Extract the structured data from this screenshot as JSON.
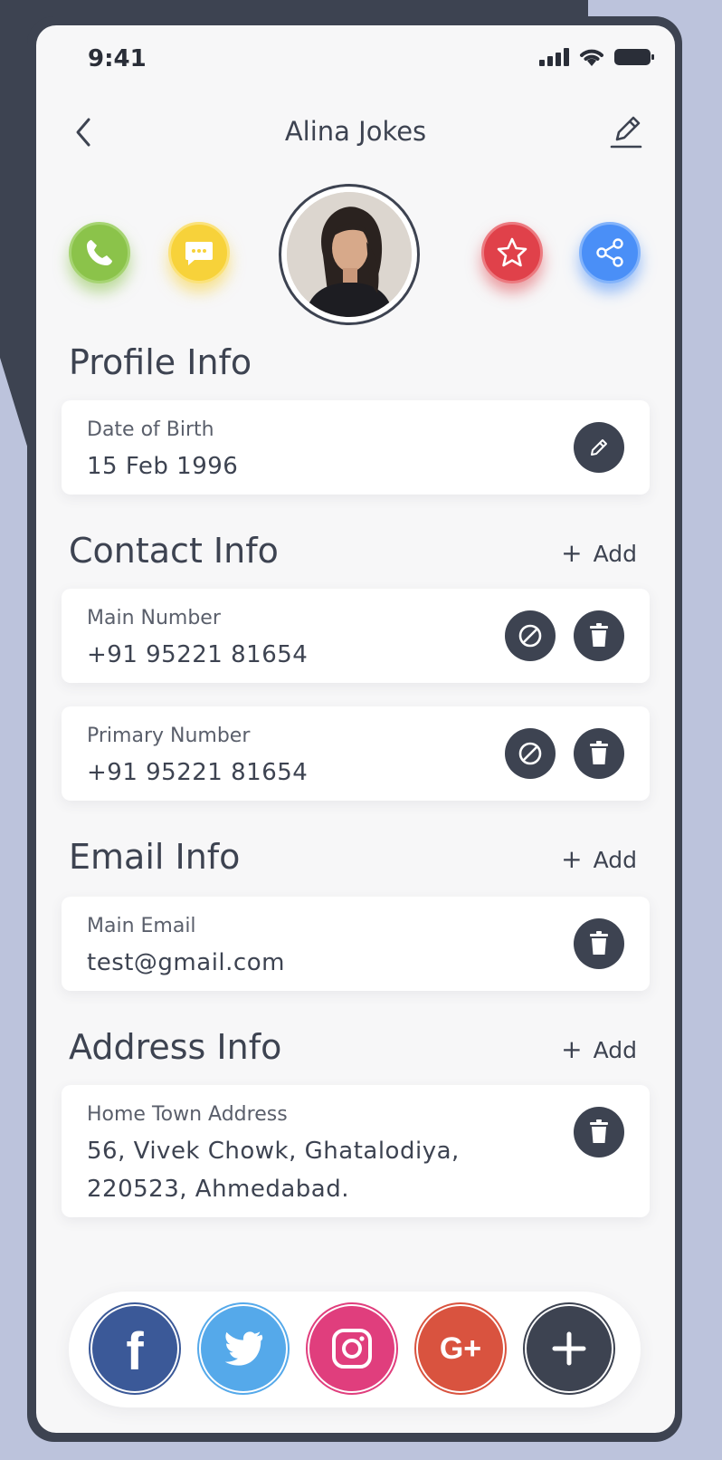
{
  "status": {
    "time": "9:41"
  },
  "header": {
    "title": "Alina Jokes"
  },
  "actions": [
    "call",
    "message",
    "favorite",
    "share"
  ],
  "profile": {
    "title": "Profile Info",
    "dob_label": "Date of Birth",
    "dob_value": "15 Feb 1996"
  },
  "contact": {
    "title": "Contact Info",
    "add_label": "Add",
    "items": [
      {
        "label": "Main Number",
        "value": "+91 95221 81654"
      },
      {
        "label": "Primary Number",
        "value": "+91 95221 81654"
      }
    ]
  },
  "email": {
    "title": "Email Info",
    "add_label": "Add",
    "items": [
      {
        "label": "Main Email",
        "value": "test@gmail.com"
      }
    ]
  },
  "address": {
    "title": "Address Info",
    "add_label": "Add",
    "items": [
      {
        "label": "Home Town Address",
        "line1": "56, Vivek Chowk, Ghatalodiya,",
        "line2": "220523, Ahmedabad."
      }
    ]
  },
  "social": {
    "facebook_glyph": "f",
    "googleplus_glyph": "G+",
    "icons": [
      "facebook-icon",
      "twitter-icon",
      "instagram-icon",
      "google-plus-icon",
      "plus-icon"
    ]
  },
  "colors": {
    "dark": "#3d4351",
    "background": "#bcc3dc",
    "call": "#8bc34a",
    "message": "#f7d23a",
    "favorite": "#e0414a",
    "share": "#4a8ff7"
  }
}
